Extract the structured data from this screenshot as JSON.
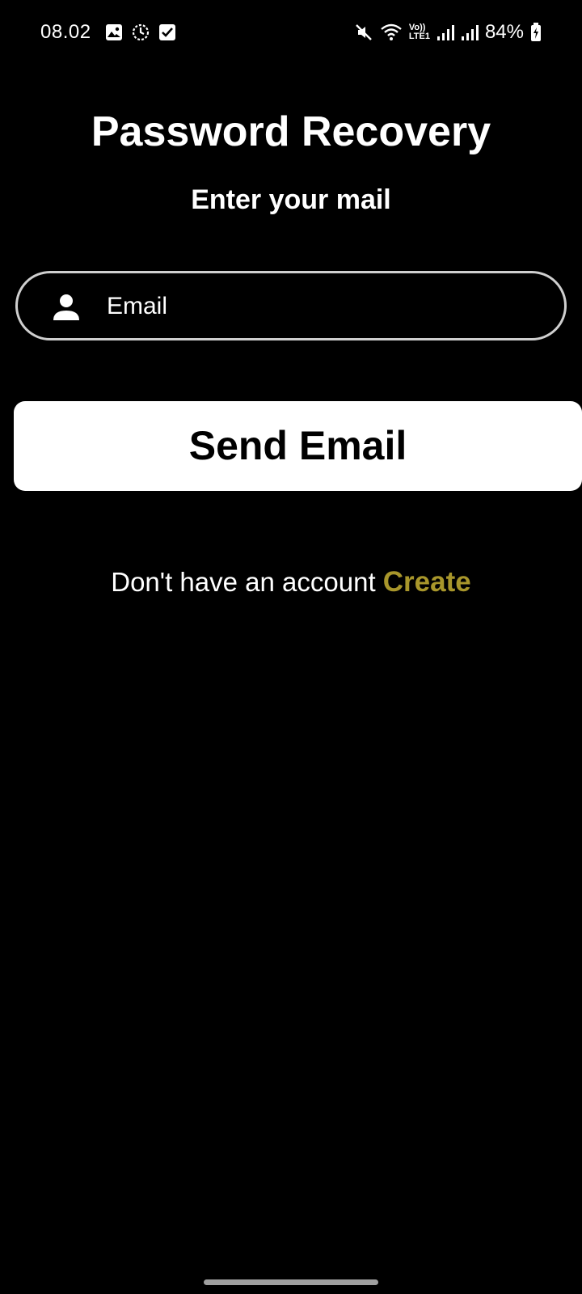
{
  "status_bar": {
    "time": "08.02",
    "battery": "84%",
    "network_label_top": "Vo))",
    "network_label_bottom": "LTE1",
    "left_icons": [
      "gallery-icon",
      "clock-sync-icon",
      "checkbox-icon"
    ],
    "right_icons": [
      "mute-icon",
      "wifi-icon",
      "signal-icon",
      "signal-icon",
      "battery-charging-icon"
    ]
  },
  "header": {
    "title": "Password Recovery",
    "subtitle": "Enter your mail"
  },
  "form": {
    "email_placeholder": "Email",
    "email_value": "",
    "email_icon": "person-icon",
    "send_label": "Send Email"
  },
  "footer": {
    "prompt_text": "Don't have an account",
    "create_label": "Create"
  },
  "colors": {
    "background": "#000000",
    "accent_link": "#a8962b",
    "button_bg": "#ffffff",
    "field_border": "#cfcfcf"
  }
}
